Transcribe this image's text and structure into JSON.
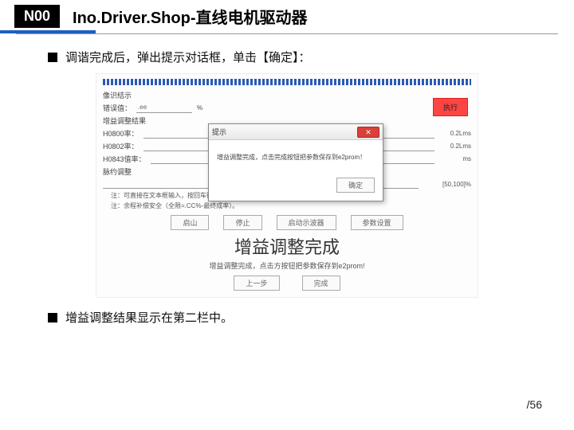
{
  "header": {
    "logo": "N00",
    "title": "Ino.Driver.Shop-直线电机驱动器"
  },
  "bullets": {
    "first": "调谐完成后，弹出提示对话框，单击【确定】：",
    "second": "增益调整结果显示在第二栏中。"
  },
  "panel": {
    "section1_label": "像识结示",
    "row1_label": "错误值：",
    "row1_value": ".ee",
    "row1_unit": "%",
    "red_button": "执行",
    "section2_label": "增益调整结果",
    "h0_label": "H0800率：",
    "h0_right": "0.2Lms",
    "h1_label": "H0802率：",
    "h1_right": "0.2Lms",
    "h2_label": "H0843值率：",
    "h2_right": "ms",
    "section3_label": "脉约调整",
    "h3_right": "[50,100]%",
    "note1": "注：可直接在文本框输入，按回车键即改变设置。",
    "note2": "注：余程补偿安全（全限=.CC%-最终成率）。",
    "btn_bt": "启山",
    "btn_stop": "停止",
    "btn_read": "启动示波器",
    "btn_save": "参数设置",
    "large_title": "增益调整完成",
    "large_sub": "增益调整完成，点击方按钮把参数保存到e2prom!",
    "btn_prev": "上一步",
    "btn_done": "完成"
  },
  "modal": {
    "title": "提示",
    "body": "增益调整完成，点击完成按钮把参数保存到e2prom！",
    "ok": "确定",
    "close": "✕"
  },
  "page": {
    "sep": "/",
    "total": "56"
  }
}
